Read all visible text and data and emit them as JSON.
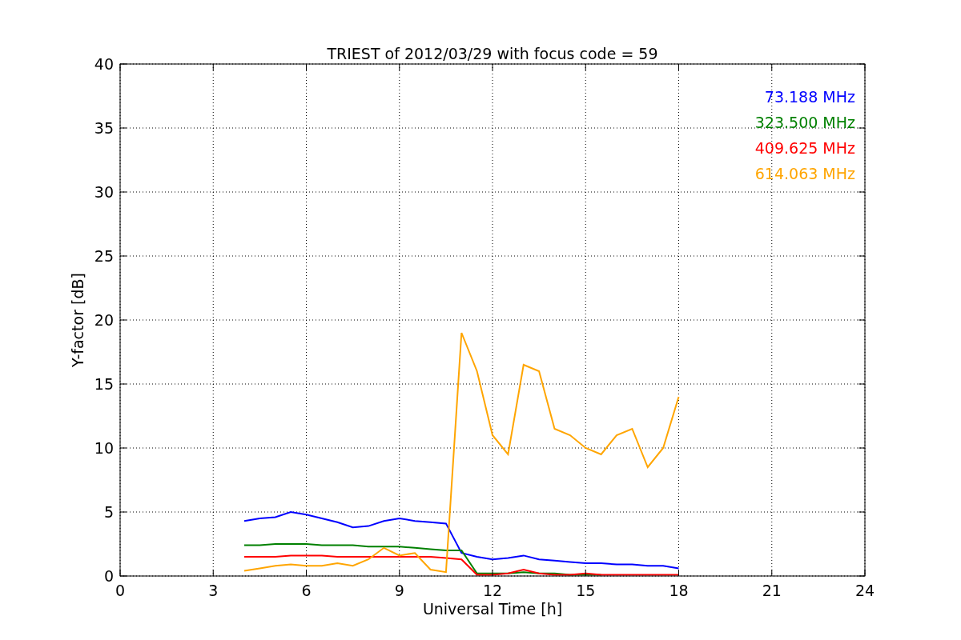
{
  "figure": {
    "chart_data": {
      "type": "line",
      "title": "TRIEST of 2012/03/29 with focus code = 59",
      "xlabel": "Universal Time [h]",
      "ylabel": "Y-factor [dB]",
      "x": [
        4,
        4.5,
        5,
        5.5,
        6,
        6.5,
        7,
        7.5,
        8,
        8.5,
        9,
        9.5,
        10,
        10.5,
        11,
        11.5,
        12,
        12.5,
        13,
        13.5,
        14,
        14.5,
        15,
        15.5,
        16,
        16.5,
        17,
        17.5,
        18
      ],
      "series": [
        {
          "name": "73.188 MHz",
          "color": "#0000ff",
          "values": [
            4.3,
            4.5,
            4.6,
            5.0,
            4.8,
            4.5,
            4.2,
            3.8,
            3.9,
            4.3,
            4.5,
            4.3,
            4.2,
            4.1,
            1.8,
            1.5,
            1.3,
            1.4,
            1.6,
            1.3,
            1.2,
            1.1,
            1.0,
            1.0,
            0.9,
            0.9,
            0.8,
            0.8,
            0.6
          ]
        },
        {
          "name": "323.500 MHz",
          "color": "#008000",
          "values": [
            2.4,
            2.4,
            2.5,
            2.5,
            2.5,
            2.4,
            2.4,
            2.4,
            2.3,
            2.3,
            2.3,
            2.2,
            2.1,
            2.0,
            2.0,
            0.2,
            0.2,
            0.2,
            0.3,
            0.2,
            0.2,
            0.1,
            0.1,
            0.1,
            null,
            null,
            null,
            null,
            null
          ]
        },
        {
          "name": "409.625 MHz",
          "color": "#ff0000",
          "values": [
            1.5,
            1.5,
            1.5,
            1.6,
            1.6,
            1.6,
            1.5,
            1.5,
            1.5,
            1.5,
            1.5,
            1.5,
            1.5,
            1.4,
            1.3,
            0.1,
            0.1,
            0.2,
            0.5,
            0.2,
            0.1,
            0.1,
            0.2,
            0.1,
            0.1,
            0.1,
            0.1,
            0.1,
            0.1
          ]
        },
        {
          "name": "614.063 MHz",
          "color": "#ffa500",
          "values": [
            0.4,
            0.6,
            0.8,
            0.9,
            0.8,
            0.8,
            1.0,
            0.8,
            1.3,
            2.2,
            1.6,
            1.8,
            0.5,
            0.3,
            19.0,
            16.0,
            11.0,
            9.5,
            16.5,
            16.0,
            11.5,
            11.0,
            10.0,
            9.5,
            11.0,
            11.5,
            8.5,
            10.0,
            14.0
          ]
        }
      ],
      "grid": true,
      "xlim": [
        0,
        24
      ],
      "ylim": [
        0,
        40
      ],
      "xticks": [
        0,
        3,
        6,
        9,
        12,
        15,
        18,
        21,
        24
      ],
      "yticks": [
        0,
        5,
        10,
        15,
        20,
        25,
        30,
        35,
        40
      ]
    }
  }
}
